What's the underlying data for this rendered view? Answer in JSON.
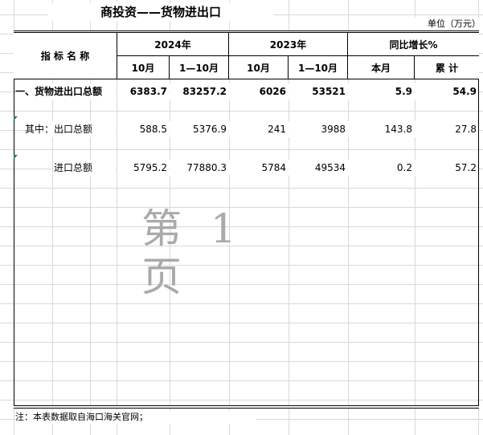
{
  "title": "商投资——货物进出口",
  "unit": "单位（万元）",
  "header": {
    "indicator": "指 标 名 称",
    "year2024": "2024年",
    "year2023": "2023年",
    "growth": "同比增长%",
    "month_2024": "10月",
    "ytd_2024": "1—10月",
    "month_2023": "10月",
    "ytd_2023": "1—10月",
    "this_month": "本月",
    "cumulative": "累 计"
  },
  "rows": [
    {
      "name": "一、货物进出口总额",
      "m2024": "6383.7",
      "y2024": "83257.2",
      "m2023": "6026",
      "y2023": "53521",
      "g_month": "5.9",
      "g_cum": "54.9"
    },
    {
      "name": "其中：出口总额",
      "m2024": "588.5",
      "y2024": "5376.9",
      "m2023": "241",
      "y2023": "3988",
      "g_month": "143.8",
      "g_cum": "27.8"
    },
    {
      "name": "进口总额",
      "m2024": "5795.2",
      "y2024": "77880.3",
      "m2023": "5784",
      "y2023": "49534",
      "g_month": "0.2",
      "g_cum": "57.2"
    }
  ],
  "watermark": "第 1 页",
  "note": "注：本表数据取自海口海关官网；",
  "colors": {
    "marker": "#1e7b34",
    "gridline": "#d9d9d9",
    "watermark": "#aaaaaa"
  }
}
